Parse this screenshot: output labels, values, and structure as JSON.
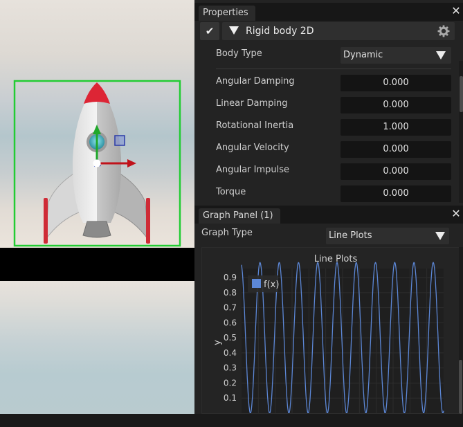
{
  "properties_panel": {
    "tab_label": "Properties",
    "close_glyph": "✕",
    "component": {
      "enabled_glyph": "✔",
      "title": "Rigid body 2D",
      "gear_icon": "gear-icon"
    },
    "body_type": {
      "label": "Body Type",
      "value": "Dynamic"
    },
    "fields": [
      {
        "label": "Angular Damping",
        "value": "0.000"
      },
      {
        "label": "Linear Damping",
        "value": "0.000"
      },
      {
        "label": "Rotational Inertia",
        "value": "1.000"
      },
      {
        "label": "Angular Velocity",
        "value": "0.000"
      },
      {
        "label": "Angular Impulse",
        "value": "0.000"
      },
      {
        "label": "Torque",
        "value": "0.000"
      }
    ]
  },
  "graph_panel": {
    "tab_label": "Graph Panel (1)",
    "close_glyph": "✕",
    "graph_type": {
      "label": "Graph Type",
      "value": "Line Plots"
    }
  },
  "colors": {
    "selection_outline": "#22cc33",
    "gizmo_y": "#1fa82a",
    "gizmo_x": "#c0121a",
    "gizmo_plane": "#3344aa",
    "series_line": "#5c87d6"
  },
  "chart_data": {
    "type": "line",
    "title": "Line Plots",
    "xlabel": "",
    "ylabel": "y",
    "ylim": [
      0.0,
      1.0
    ],
    "yticks": [
      "0.9",
      "0.8",
      "0.7",
      "0.6",
      "0.5",
      "0.4",
      "0.3",
      "0.2",
      "0.1"
    ],
    "grid": true,
    "legend_position": "top-left",
    "series": [
      {
        "name": "f(x)",
        "cycles_visible": 10.5,
        "min": 0.0,
        "max": 1.0,
        "color": "#5c87d6"
      }
    ]
  }
}
